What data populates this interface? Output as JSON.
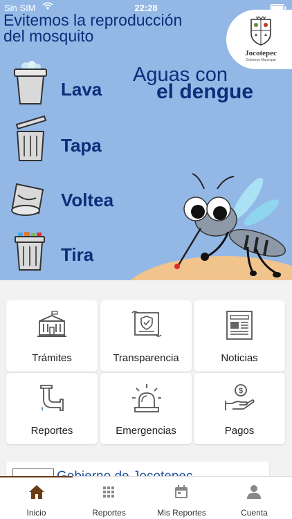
{
  "status_bar": {
    "carrier": "Sin SIM",
    "time": "22:28"
  },
  "banner": {
    "headline_line1": "Evitemos la reproducción",
    "headline_line2": "del mosquito",
    "campaign_line1": "Aguas con",
    "campaign_line2": "el dengue",
    "steps": [
      "Lava",
      "Tapa",
      "Voltea",
      "Tira"
    ],
    "logo_name": "Jocotepec",
    "logo_subtitle": "Gobierno Municipal"
  },
  "menu": [
    {
      "label": "Trámites",
      "icon": "government-building-icon"
    },
    {
      "label": "Transparencia",
      "icon": "certificate-scroll-icon"
    },
    {
      "label": "Noticias",
      "icon": "newspaper-icon"
    },
    {
      "label": "Reportes",
      "icon": "water-pipe-icon"
    },
    {
      "label": "Emergencias",
      "icon": "siren-icon"
    },
    {
      "label": "Pagos",
      "icon": "hand-money-icon"
    }
  ],
  "gov_card": {
    "title": "Gobierno de Jocotepec"
  },
  "tab_bar": {
    "tabs": [
      {
        "label": "Inicio",
        "icon": "home-icon",
        "active": true
      },
      {
        "label": "Reportes",
        "icon": "grid-icon",
        "active": false
      },
      {
        "label": "Mis Reportes",
        "icon": "calendar-icon",
        "active": false
      },
      {
        "label": "Cuenta",
        "icon": "person-icon",
        "active": false
      }
    ],
    "active_color": "#6b3c13"
  },
  "colors": {
    "banner_blue": "#93b8e6",
    "title_navy": "#0d2d7a",
    "link_blue": "#1e4f9e"
  }
}
